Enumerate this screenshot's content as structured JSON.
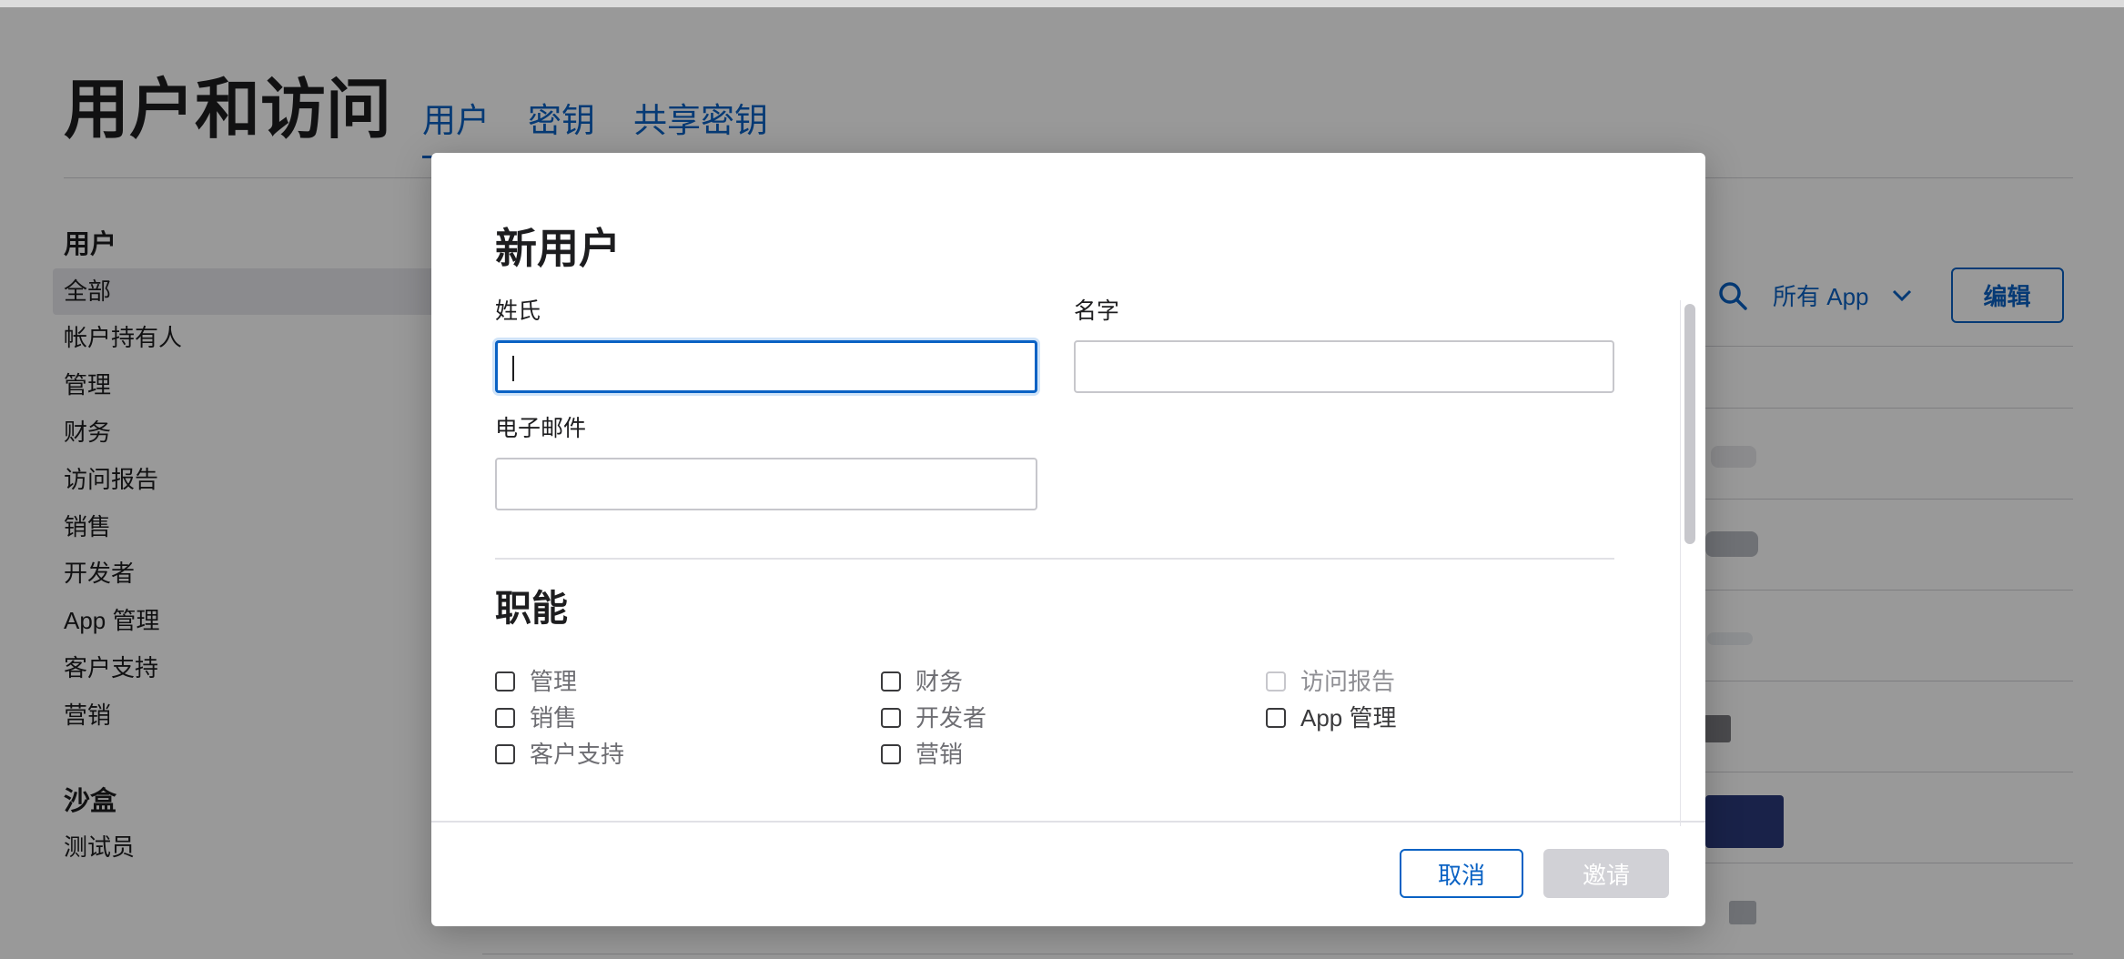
{
  "page": {
    "title": "用户和访问",
    "tabs": [
      {
        "label": "用户",
        "active": true
      },
      {
        "label": "密钥",
        "active": false
      },
      {
        "label": "共享密钥",
        "active": false
      }
    ]
  },
  "sidebar": {
    "users_heading": "用户",
    "items": [
      "全部",
      "帐户持有人",
      "管理",
      "财务",
      "访问报告",
      "销售",
      "开发者",
      "App 管理",
      "客户支持",
      "营销"
    ],
    "active_item": "全部",
    "sandbox_heading": "沙盒",
    "sandbox_items": [
      "测试员"
    ]
  },
  "toolbar": {
    "search_icon": "search-icon",
    "filter_label": "所有 App",
    "filter_icon": "chevron-down-icon",
    "edit_label": "编辑"
  },
  "modal": {
    "title": "新用户",
    "last_name_label": "姓氏",
    "last_name_value": "",
    "first_name_label": "名字",
    "first_name_value": "",
    "email_label": "电子邮件",
    "email_value": "",
    "roles_title": "职能",
    "roles": [
      {
        "label": "管理",
        "checked": false,
        "disabled": false
      },
      {
        "label": "财务",
        "checked": false,
        "disabled": false
      },
      {
        "label": "访问报告",
        "checked": false,
        "disabled": true
      },
      {
        "label": "销售",
        "checked": false,
        "disabled": false
      },
      {
        "label": "开发者",
        "checked": false,
        "disabled": false
      },
      {
        "label": "App 管理",
        "checked": false,
        "disabled": false
      },
      {
        "label": "客户支持",
        "checked": false,
        "disabled": false
      },
      {
        "label": "营销",
        "checked": false,
        "disabled": false
      }
    ],
    "cancel_label": "取消",
    "invite_label": "邀请"
  },
  "colors": {
    "accent": "#0a62c4",
    "overlay": "rgba(0,0,0,0.40)",
    "disabled_button": "#d1d1d6"
  }
}
